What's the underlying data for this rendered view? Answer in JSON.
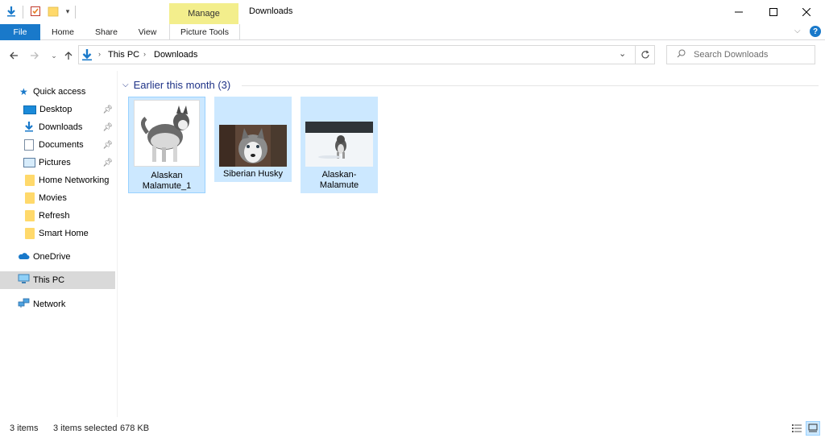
{
  "titlebar": {
    "title": "Downloads",
    "manage_label": "Manage"
  },
  "ribbon": {
    "file": "File",
    "tabs": [
      "Home",
      "Share",
      "View"
    ],
    "picture_tools": "Picture Tools"
  },
  "address": {
    "crumbs": [
      "This PC",
      "Downloads"
    ]
  },
  "search": {
    "placeholder": "Search Downloads"
  },
  "sidebar": {
    "quick_access": "Quick access",
    "pinned": [
      "Desktop",
      "Downloads",
      "Documents",
      "Pictures"
    ],
    "folders": [
      "Home Networking",
      "Movies",
      "Refresh",
      "Smart Home"
    ],
    "onedrive": "OneDrive",
    "this_pc": "This PC",
    "network": "Network"
  },
  "content": {
    "group_title": "Earlier this month (3)",
    "files": [
      {
        "name": "Alaskan Malamute_1"
      },
      {
        "name": "Siberian Husky"
      },
      {
        "name": "Alaskan-Malamute"
      }
    ]
  },
  "status": {
    "items": "3 items",
    "selected": "3 items selected",
    "size": "678 KB"
  },
  "colors": {
    "accent": "#1979ca",
    "selection": "#cce8ff",
    "manage_tab": "#f3ee8c",
    "group_header": "#1e3287"
  }
}
